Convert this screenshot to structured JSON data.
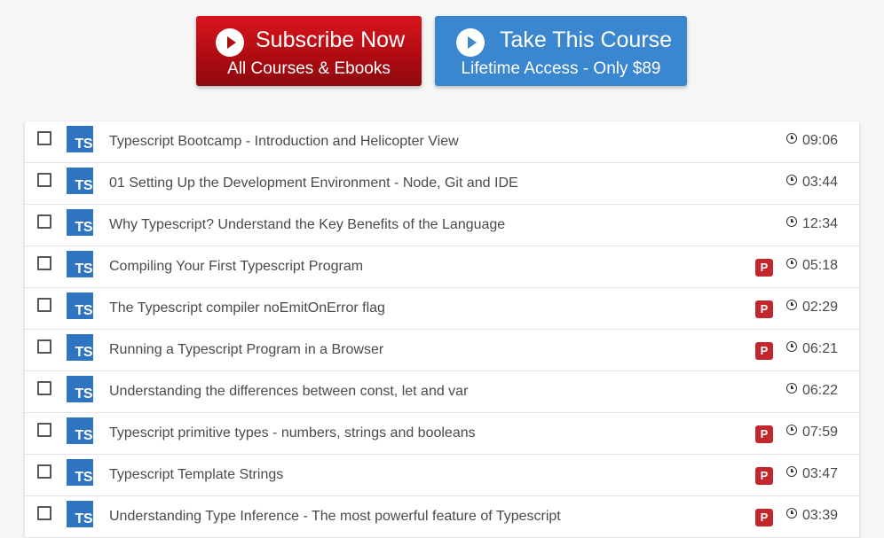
{
  "cta": {
    "subscribe": {
      "title": "Subscribe Now",
      "subtitle": "All Courses & Ebooks",
      "icon": "play-circle-icon",
      "color": "#b10b12"
    },
    "course": {
      "title": "Take This Course",
      "subtitle": "Lifetime Access - Only $89",
      "icon": "play-circle-icon",
      "color": "#3a86cf"
    }
  },
  "lesson_icon_label": "TS",
  "premium_badge_label": "P",
  "colors": {
    "ts_icon": "#2f74c0",
    "premium_badge": "#c1272d"
  },
  "lessons": [
    {
      "title": "Typescript Bootcamp - Introduction and Helicopter View",
      "duration": "09:06",
      "premium": false
    },
    {
      "title": "01 Setting Up the Development Environment - Node, Git and IDE",
      "duration": "03:44",
      "premium": false
    },
    {
      "title": "Why Typescript? Understand the Key Benefits of the Language",
      "duration": "12:34",
      "premium": false
    },
    {
      "title": "Compiling Your First Typescript Program",
      "duration": "05:18",
      "premium": true
    },
    {
      "title": "The Typescript compiler noEmitOnError flag",
      "duration": "02:29",
      "premium": true
    },
    {
      "title": "Running a Typescript Program in a Browser",
      "duration": "06:21",
      "premium": true
    },
    {
      "title": "Understanding the differences between const, let and var",
      "duration": "06:22",
      "premium": false
    },
    {
      "title": "Typescript primitive types - numbers, strings and booleans",
      "duration": "07:59",
      "premium": true
    },
    {
      "title": "Typescript Template Strings",
      "duration": "03:47",
      "premium": true
    },
    {
      "title": "Understanding Type Inference - The most powerful feature of Typescript",
      "duration": "03:39",
      "premium": true
    }
  ]
}
